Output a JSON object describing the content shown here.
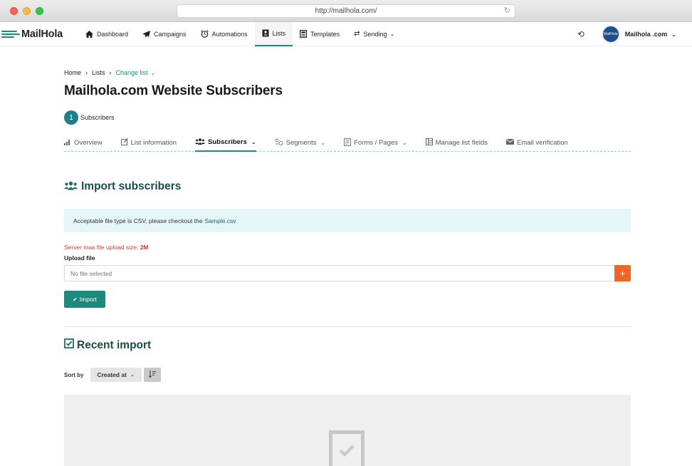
{
  "browser": {
    "url": "http://mailhola.com/"
  },
  "app": {
    "name": "MailHola"
  },
  "nav": {
    "items": [
      {
        "label": "Dashboard",
        "icon": "home-icon"
      },
      {
        "label": "Campaigns",
        "icon": "paper-plane-icon"
      },
      {
        "label": "Automations",
        "icon": "alarm-clock-icon"
      },
      {
        "label": "Lists",
        "icon": "address-book-icon",
        "active": true
      },
      {
        "label": "Templates",
        "icon": "template-icon"
      },
      {
        "label": "Sending",
        "icon": "exchange-icon",
        "dropdown": true
      }
    ],
    "user": {
      "name": "Mailhola .com",
      "avatar_text": "MailHola"
    }
  },
  "breadcrumb": {
    "home": "Home",
    "lists": "Lists",
    "change_list": "Change list"
  },
  "page": {
    "title": "Mailhola.com Website Subscribers",
    "subscriber_count": "1",
    "subscriber_label": "Subscribers"
  },
  "tabs": [
    {
      "label": "Overview",
      "icon": "bar-chart-icon"
    },
    {
      "label": "List information",
      "icon": "edit-icon"
    },
    {
      "label": "Subscribers",
      "icon": "users-icon",
      "active": true,
      "dropdown": true
    },
    {
      "label": "Segments",
      "icon": "segments-icon",
      "dropdown": true
    },
    {
      "label": "Forms / Pages",
      "icon": "form-icon",
      "dropdown": true
    },
    {
      "label": "Manage list fields",
      "icon": "fields-icon"
    },
    {
      "label": "Email verification",
      "icon": "envelope-icon"
    }
  ],
  "import": {
    "title": "Import subscribers",
    "alert_text": "Acceptable file type is CSV, please checkout the",
    "alert_link": "Sample.csv",
    "max_size_label": "Server max file upload size:",
    "max_size_value": "2M",
    "upload_label": "Upload file",
    "file_placeholder": "No file selected",
    "add_symbol": "+",
    "button_label": "Import"
  },
  "recent": {
    "title": "Recent import",
    "sort_label": "Sort by",
    "sort_value": "Created at"
  }
}
